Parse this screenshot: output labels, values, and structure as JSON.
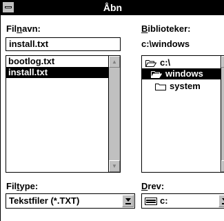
{
  "window": {
    "title": "Åbn"
  },
  "filename": {
    "label_pre": "Fil",
    "label_u": "n",
    "label_post": "avn:",
    "value": "install.txt"
  },
  "directories": {
    "label_pre": "",
    "label_u": "B",
    "label_post": "iblioteker:",
    "path": "c:\\windows"
  },
  "files": {
    "items": [
      "bootlog.txt",
      "install.txt"
    ],
    "selected_index": 1
  },
  "dir_tree": {
    "items": [
      {
        "label": "c:\\",
        "icon": "open-folder-icon",
        "state": "open"
      },
      {
        "label": "windows",
        "icon": "open-folder-icon",
        "state": "selected"
      },
      {
        "label": "system",
        "icon": "closed-folder-icon",
        "state": "closed"
      }
    ]
  },
  "filetype": {
    "label_pre": "Fil",
    "label_u": "t",
    "label_post": "ype:",
    "value": "Tekstfiler (*.TXT)"
  },
  "drives": {
    "label_pre": "",
    "label_u": "D",
    "label_post": "rev:",
    "value": "c:",
    "icon": "drive-icon"
  },
  "colors": {
    "titlebar": "#000000",
    "selection": "#000000",
    "scroll": "#c0c0c0"
  }
}
